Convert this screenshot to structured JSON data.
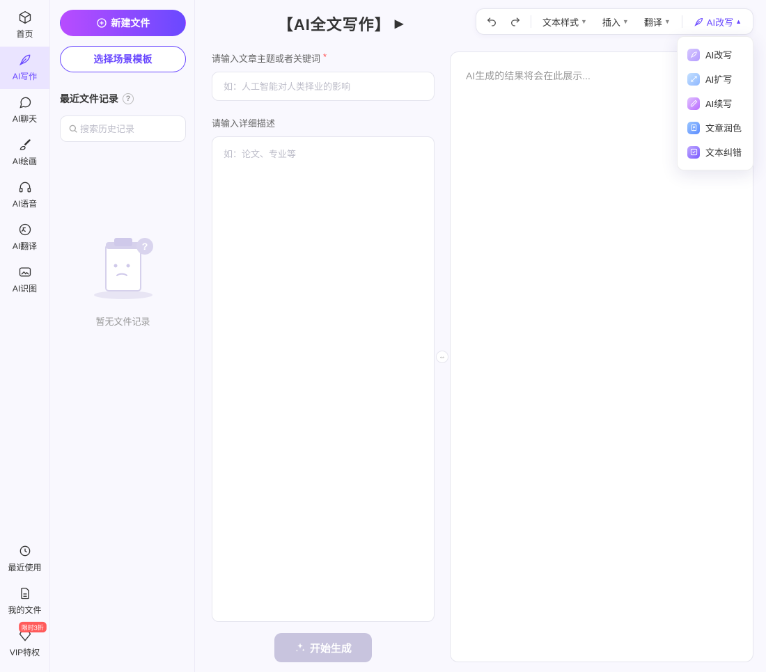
{
  "sidebar": {
    "top": [
      {
        "id": "home",
        "label": "首页"
      },
      {
        "id": "write",
        "label": "AI写作",
        "active": true
      },
      {
        "id": "chat",
        "label": "AI聊天"
      },
      {
        "id": "draw",
        "label": "AI绘画"
      },
      {
        "id": "voice",
        "label": "AI语音"
      },
      {
        "id": "trans",
        "label": "AI翻译"
      },
      {
        "id": "image",
        "label": "AI识图"
      }
    ],
    "bottom": [
      {
        "id": "recent",
        "label": "最近使用"
      },
      {
        "id": "myfile",
        "label": "我的文件"
      },
      {
        "id": "vip",
        "label": "VIP特权",
        "badge": "限时3折"
      }
    ]
  },
  "panelFiles": {
    "newFile": "新建文件",
    "chooseTemplate": "选择场景模板",
    "sectionTitle": "最近文件记录",
    "searchPlaceholder": "搜索历史记录",
    "emptyText": "暂无文件记录"
  },
  "pageTitle": "【AI全文写作】",
  "toolbar": {
    "textStyle": "文本样式",
    "insert": "插入",
    "translate": "翻译",
    "rewrite": "AI改写"
  },
  "dropdown": {
    "items": [
      {
        "label": "AI改写"
      },
      {
        "label": "AI扩写"
      },
      {
        "label": "AI续写"
      },
      {
        "label": "文章润色"
      },
      {
        "label": "文本纠错"
      }
    ]
  },
  "form": {
    "topicLabel": "请输入文章主题或者关键词",
    "topicPlaceholder": "如：人工智能对人类择业的影响",
    "detailLabel": "请输入详细描述",
    "detailPlaceholder": "如：论文、专业等",
    "generate": "开始生成"
  },
  "output": {
    "placeholder": "AI生成的结果将会在此展示..."
  }
}
